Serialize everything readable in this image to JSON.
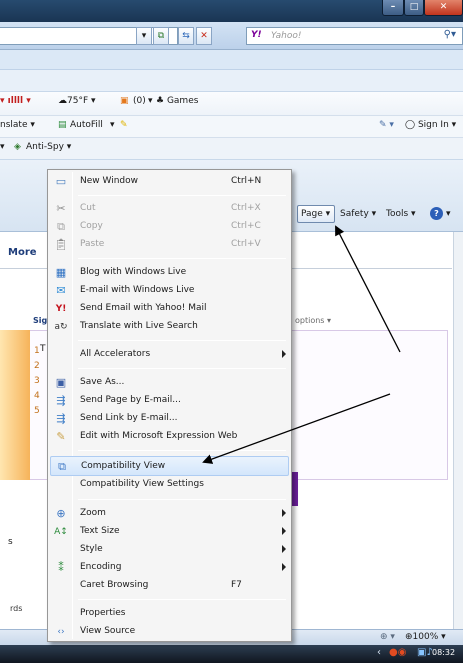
{
  "browser": {
    "search_provider": "Yahoo!",
    "yahoo_logo": "Y!",
    "toolbar1": {
      "weather": "75°F",
      "feeds": "(0)",
      "games": "Games"
    },
    "toolbar2": {
      "translate": "nslate",
      "autofill": "AutoFill",
      "sign_in": "Sign In"
    },
    "toolbar3": {
      "anti_spy": "Anti-Spy"
    },
    "command_bar": {
      "page": "Page",
      "safety": "Safety",
      "tools": "Tools"
    }
  },
  "page_content": {
    "more": "More",
    "sign": "Sign",
    "options": "options",
    "t_label": "T",
    "numbers": [
      "1",
      "2",
      "3",
      "4",
      "5"
    ],
    "s_label": "s",
    "rds_label": "rds"
  },
  "statusbar": {
    "zoom": "100%"
  },
  "taskbar": {
    "clock": "08:32"
  },
  "menu": {
    "new_window": {
      "label": "New Window",
      "shortcut": "Ctrl+N"
    },
    "cut": {
      "label": "Cut",
      "shortcut": "Ctrl+X"
    },
    "copy": {
      "label": "Copy",
      "shortcut": "Ctrl+C"
    },
    "paste": {
      "label": "Paste",
      "shortcut": "Ctrl+V"
    },
    "blog": {
      "label": "Blog with Windows Live"
    },
    "email_live": {
      "label": "E-mail with Windows Live"
    },
    "send_yahoo": {
      "label": "Send Email with Yahoo! Mail"
    },
    "translate": {
      "label": "Translate with Live Search"
    },
    "accelerators": {
      "label": "All Accelerators"
    },
    "save_as": {
      "label": "Save As..."
    },
    "send_page": {
      "label": "Send Page by E-mail..."
    },
    "send_link": {
      "label": "Send Link by E-mail..."
    },
    "edit_expression": {
      "label": "Edit with Microsoft Expression Web"
    },
    "compat_view": {
      "label": "Compatibility View"
    },
    "compat_settings": {
      "label": "Compatibility View Settings"
    },
    "zoom": {
      "label": "Zoom"
    },
    "text_size": {
      "label": "Text Size"
    },
    "style": {
      "label": "Style"
    },
    "encoding": {
      "label": "Encoding"
    },
    "caret": {
      "label": "Caret Browsing",
      "shortcut": "F7"
    },
    "properties": {
      "label": "Properties"
    },
    "view_source": {
      "label": "View Source"
    }
  }
}
